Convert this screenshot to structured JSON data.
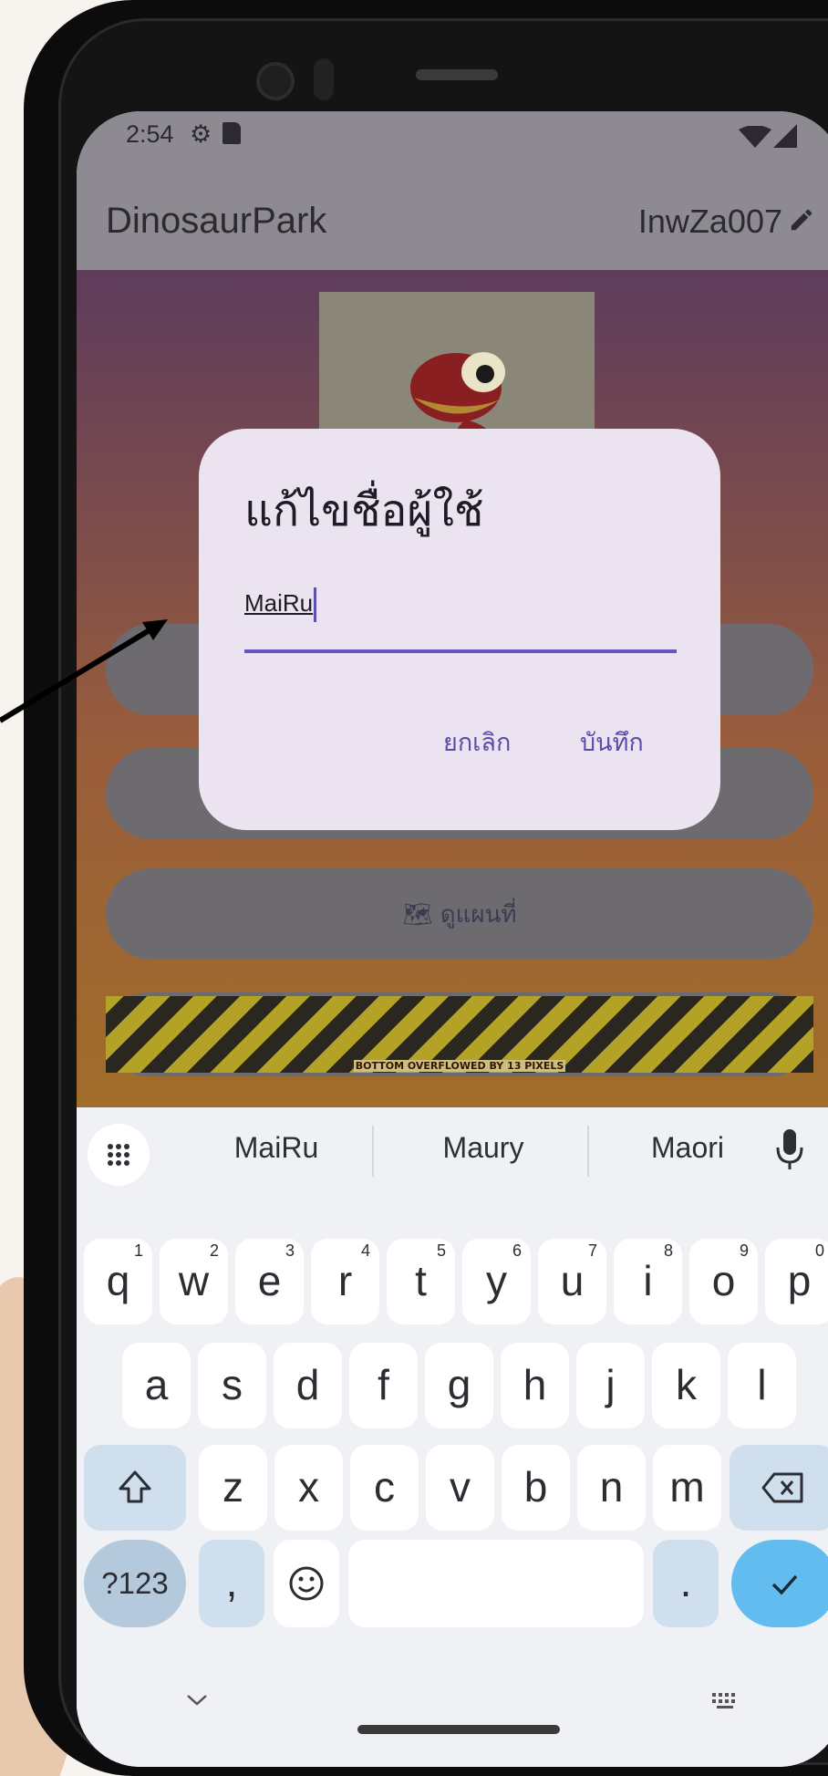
{
  "status_bar": {
    "time": "2:54",
    "left_icons": [
      "gear-icon",
      "sd-card-icon"
    ],
    "right_icons": [
      "wifi-icon",
      "signal-icon"
    ]
  },
  "app_bar": {
    "title": "DinosaurPark",
    "username": "InwZa007"
  },
  "background": {
    "map_button_label": "🗺 ดูแผนที่",
    "overflow_text": "BOTTOM OVERFLOWED BY 13 PIXELS"
  },
  "dialog": {
    "title": "แก้ไขชื่อผู้ใช้",
    "input_value": "MaiRu",
    "cancel_label": "ยกเลิก",
    "save_label": "บันทึก"
  },
  "keyboard": {
    "suggestions": [
      "MaiRu",
      "Maury",
      "Maori"
    ],
    "row1": [
      "q",
      "w",
      "e",
      "r",
      "t",
      "y",
      "u",
      "i",
      "o",
      "p"
    ],
    "row1_hints": [
      "1",
      "2",
      "3",
      "4",
      "5",
      "6",
      "7",
      "8",
      "9",
      "0"
    ],
    "row2": [
      "a",
      "s",
      "d",
      "f",
      "g",
      "h",
      "j",
      "k",
      "l"
    ],
    "row3": [
      "z",
      "x",
      "c",
      "v",
      "b",
      "n",
      "m"
    ],
    "symbols_label": "?123",
    "comma_label": ",",
    "period_label": ".",
    "emoji_icon": "emoji-icon",
    "shift_icon": "shift-icon",
    "backspace_icon": "backspace-icon",
    "enter_icon": "check-icon"
  },
  "colors": {
    "accent": "#6656c0",
    "enter_key": "#62bcf0",
    "func_key": "#cfdfee"
  }
}
